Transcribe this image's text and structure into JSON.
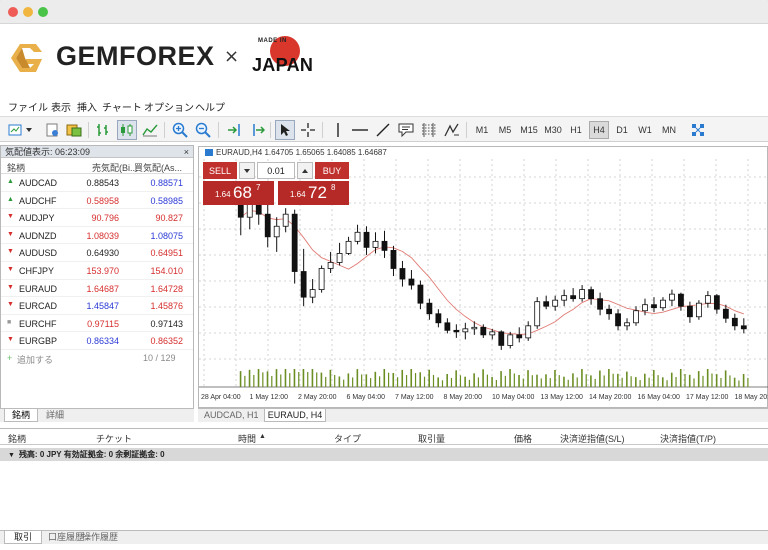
{
  "banner": {
    "brand": "GEMFOREX",
    "times": "×",
    "made_in": "MADE IN",
    "japan": "JAPAN"
  },
  "menu": [
    "ファイル",
    "表示",
    "挿入",
    "チャート",
    "オプション",
    "ヘルプ"
  ],
  "timeframes": [
    "M1",
    "M5",
    "M15",
    "M30",
    "H1",
    "H4",
    "D1",
    "W1",
    "MN"
  ],
  "market_watch": {
    "header": "気配値表示: 06:23:09",
    "close": "×",
    "col_symbol": "銘柄",
    "col_bid": "売気配(Bi...",
    "col_ask": "買気配(As...",
    "rows": [
      {
        "symbol": "AUDCAD",
        "bid": "0.88543",
        "ask": "0.88571",
        "dir": "up",
        "bid_color": "dark",
        "ask_color": "blue"
      },
      {
        "symbol": "AUDCHF",
        "bid": "0.58958",
        "ask": "0.58985",
        "dir": "up",
        "bid_color": "red",
        "ask_color": "blue"
      },
      {
        "symbol": "AUDJPY",
        "bid": "90.796",
        "ask": "90.827",
        "dir": "down",
        "bid_color": "red",
        "ask_color": "red"
      },
      {
        "symbol": "AUDNZD",
        "bid": "1.08039",
        "ask": "1.08075",
        "dir": "down",
        "bid_color": "red",
        "ask_color": "blue"
      },
      {
        "symbol": "AUDUSD",
        "bid": "0.64930",
        "ask": "0.64951",
        "dir": "down",
        "bid_color": "dark",
        "ask_color": "red"
      },
      {
        "symbol": "CHFJPY",
        "bid": "153.970",
        "ask": "154.010",
        "dir": "down",
        "bid_color": "red",
        "ask_color": "red"
      },
      {
        "symbol": "EURAUD",
        "bid": "1.64687",
        "ask": "1.64728",
        "dir": "down",
        "bid_color": "red",
        "ask_color": "red"
      },
      {
        "symbol": "EURCAD",
        "bid": "1.45847",
        "ask": "1.45876",
        "dir": "down",
        "bid_color": "blue",
        "ask_color": "red"
      },
      {
        "symbol": "EURCHF",
        "bid": "0.97115",
        "ask": "0.97143",
        "dir": "neutral",
        "bid_color": "red",
        "ask_color": "dark"
      },
      {
        "symbol": "EURGBP",
        "bid": "0.86334",
        "ask": "0.86352",
        "dir": "down",
        "bid_color": "blue",
        "ask_color": "red"
      }
    ],
    "add_label": "追加する",
    "count": "10 / 129",
    "tabs": [
      "銘柄",
      "詳細"
    ]
  },
  "chart_window": {
    "header": "EURAUD,H4  1.64705 1.65065 1.64085 1.64687",
    "tabs": [
      "AUDCAD, H1",
      "EURAUD, H4"
    ]
  },
  "trade_panel": {
    "sell": "SELL",
    "buy": "BUY",
    "lot": "0.01",
    "sell_prefix": "1.64",
    "sell_big": "68",
    "sell_sup": "7",
    "buy_prefix": "1.64",
    "buy_big": "72",
    "buy_sup": "8"
  },
  "chart_data": {
    "type": "candlestick",
    "x_tick_labels": [
      "28 Apr 04:00",
      "1 May 12:00",
      "2 May 20:00",
      "6 May 04:00",
      "7 May 12:00",
      "8 May 20:00",
      "10 May 04:00",
      "13 May 12:00",
      "14 May 20:00",
      "16 May 04:00",
      "17 May 12:00",
      "18 May 20:00"
    ],
    "candles": [
      {
        "o": 1.6556,
        "h": 1.6565,
        "l": 1.6532,
        "c": 1.6544
      },
      {
        "o": 1.6544,
        "h": 1.656,
        "l": 1.6536,
        "c": 1.6553
      },
      {
        "o": 1.6553,
        "h": 1.6562,
        "l": 1.6539,
        "c": 1.6546
      },
      {
        "o": 1.6546,
        "h": 1.6553,
        "l": 1.6524,
        "c": 1.6531
      },
      {
        "o": 1.6531,
        "h": 1.6544,
        "l": 1.6521,
        "c": 1.6538
      },
      {
        "o": 1.6538,
        "h": 1.655,
        "l": 1.6534,
        "c": 1.6546
      },
      {
        "o": 1.6546,
        "h": 1.6549,
        "l": 1.65,
        "c": 1.6508
      },
      {
        "o": 1.6508,
        "h": 1.6523,
        "l": 1.6485,
        "c": 1.6491
      },
      {
        "o": 1.6491,
        "h": 1.6503,
        "l": 1.6487,
        "c": 1.6496
      },
      {
        "o": 1.6496,
        "h": 1.6512,
        "l": 1.6494,
        "c": 1.651
      },
      {
        "o": 1.651,
        "h": 1.6521,
        "l": 1.6507,
        "c": 1.6514
      },
      {
        "o": 1.6514,
        "h": 1.6527,
        "l": 1.6512,
        "c": 1.652
      },
      {
        "o": 1.652,
        "h": 1.6531,
        "l": 1.6519,
        "c": 1.6528
      },
      {
        "o": 1.6528,
        "h": 1.6539,
        "l": 1.6526,
        "c": 1.6534
      },
      {
        "o": 1.6534,
        "h": 1.6538,
        "l": 1.6519,
        "c": 1.6524
      },
      {
        "o": 1.6524,
        "h": 1.6534,
        "l": 1.652,
        "c": 1.6528
      },
      {
        "o": 1.6528,
        "h": 1.6535,
        "l": 1.6517,
        "c": 1.6522
      },
      {
        "o": 1.6522,
        "h": 1.6525,
        "l": 1.6505,
        "c": 1.651
      },
      {
        "o": 1.651,
        "h": 1.6515,
        "l": 1.6498,
        "c": 1.6503
      },
      {
        "o": 1.6503,
        "h": 1.6509,
        "l": 1.6496,
        "c": 1.6499
      },
      {
        "o": 1.6499,
        "h": 1.6502,
        "l": 1.6483,
        "c": 1.6487
      },
      {
        "o": 1.6487,
        "h": 1.649,
        "l": 1.6476,
        "c": 1.648
      },
      {
        "o": 1.648,
        "h": 1.6483,
        "l": 1.6471,
        "c": 1.6474
      },
      {
        "o": 1.6474,
        "h": 1.6477,
        "l": 1.6467,
        "c": 1.6469
      },
      {
        "o": 1.6469,
        "h": 1.6473,
        "l": 1.6464,
        "c": 1.6468
      },
      {
        "o": 1.6468,
        "h": 1.6474,
        "l": 1.6463,
        "c": 1.647
      },
      {
        "o": 1.647,
        "h": 1.6475,
        "l": 1.6466,
        "c": 1.6471
      },
      {
        "o": 1.6471,
        "h": 1.6473,
        "l": 1.6464,
        "c": 1.6466
      },
      {
        "o": 1.6466,
        "h": 1.647,
        "l": 1.6463,
        "c": 1.6468
      },
      {
        "o": 1.6468,
        "h": 1.6469,
        "l": 1.6456,
        "c": 1.6459
      },
      {
        "o": 1.6459,
        "h": 1.6468,
        "l": 1.6457,
        "c": 1.6466
      },
      {
        "o": 1.6466,
        "h": 1.6471,
        "l": 1.6461,
        "c": 1.6464
      },
      {
        "o": 1.6464,
        "h": 1.6475,
        "l": 1.6462,
        "c": 1.6472
      },
      {
        "o": 1.6472,
        "h": 1.6491,
        "l": 1.647,
        "c": 1.6488
      },
      {
        "o": 1.6488,
        "h": 1.6492,
        "l": 1.6483,
        "c": 1.6485
      },
      {
        "o": 1.6485,
        "h": 1.6492,
        "l": 1.6482,
        "c": 1.6489
      },
      {
        "o": 1.6489,
        "h": 1.6496,
        "l": 1.6485,
        "c": 1.6492
      },
      {
        "o": 1.6492,
        "h": 1.6497,
        "l": 1.6488,
        "c": 1.649
      },
      {
        "o": 1.649,
        "h": 1.6499,
        "l": 1.6488,
        "c": 1.6496
      },
      {
        "o": 1.6496,
        "h": 1.6498,
        "l": 1.6486,
        "c": 1.649
      },
      {
        "o": 1.649,
        "h": 1.6494,
        "l": 1.6479,
        "c": 1.6483
      },
      {
        "o": 1.6483,
        "h": 1.6486,
        "l": 1.6476,
        "c": 1.648
      },
      {
        "o": 1.648,
        "h": 1.6483,
        "l": 1.6469,
        "c": 1.6472
      },
      {
        "o": 1.6472,
        "h": 1.6477,
        "l": 1.6469,
        "c": 1.6474
      },
      {
        "o": 1.6474,
        "h": 1.6485,
        "l": 1.6472,
        "c": 1.6482
      },
      {
        "o": 1.6482,
        "h": 1.649,
        "l": 1.6479,
        "c": 1.6486
      },
      {
        "o": 1.6486,
        "h": 1.6491,
        "l": 1.6481,
        "c": 1.6484
      },
      {
        "o": 1.6484,
        "h": 1.6491,
        "l": 1.6482,
        "c": 1.6489
      },
      {
        "o": 1.6489,
        "h": 1.6496,
        "l": 1.6485,
        "c": 1.6493
      },
      {
        "o": 1.6493,
        "h": 1.6494,
        "l": 1.6482,
        "c": 1.6485
      },
      {
        "o": 1.6485,
        "h": 1.6488,
        "l": 1.6474,
        "c": 1.6478
      },
      {
        "o": 1.6478,
        "h": 1.6489,
        "l": 1.6476,
        "c": 1.6487
      },
      {
        "o": 1.6487,
        "h": 1.6495,
        "l": 1.6484,
        "c": 1.6492
      },
      {
        "o": 1.6492,
        "h": 1.6493,
        "l": 1.648,
        "c": 1.6483
      },
      {
        "o": 1.6483,
        "h": 1.6486,
        "l": 1.6474,
        "c": 1.6477
      },
      {
        "o": 1.6477,
        "h": 1.648,
        "l": 1.6469,
        "c": 1.6472
      },
      {
        "o": 1.6472,
        "h": 1.6477,
        "l": 1.6467,
        "c": 1.647
      }
    ]
  },
  "terminal": {
    "cols": [
      "銘柄",
      "チケット",
      "時間",
      "タイプ",
      "取引量",
      "価格",
      "決済逆指値(S/L)",
      "決済指値(T/P)"
    ],
    "summary": "残高: 0 JPY  有効証拠金: 0  余剰証拠金: 0",
    "tabs": [
      "取引",
      "口座履歴",
      "操作履歴"
    ]
  },
  "colors": {
    "red": "#d62e2e",
    "blue": "#2a39d6",
    "green": "#2a9a3a",
    "trade_red": "#c0302c",
    "ma": "#e07a73"
  }
}
